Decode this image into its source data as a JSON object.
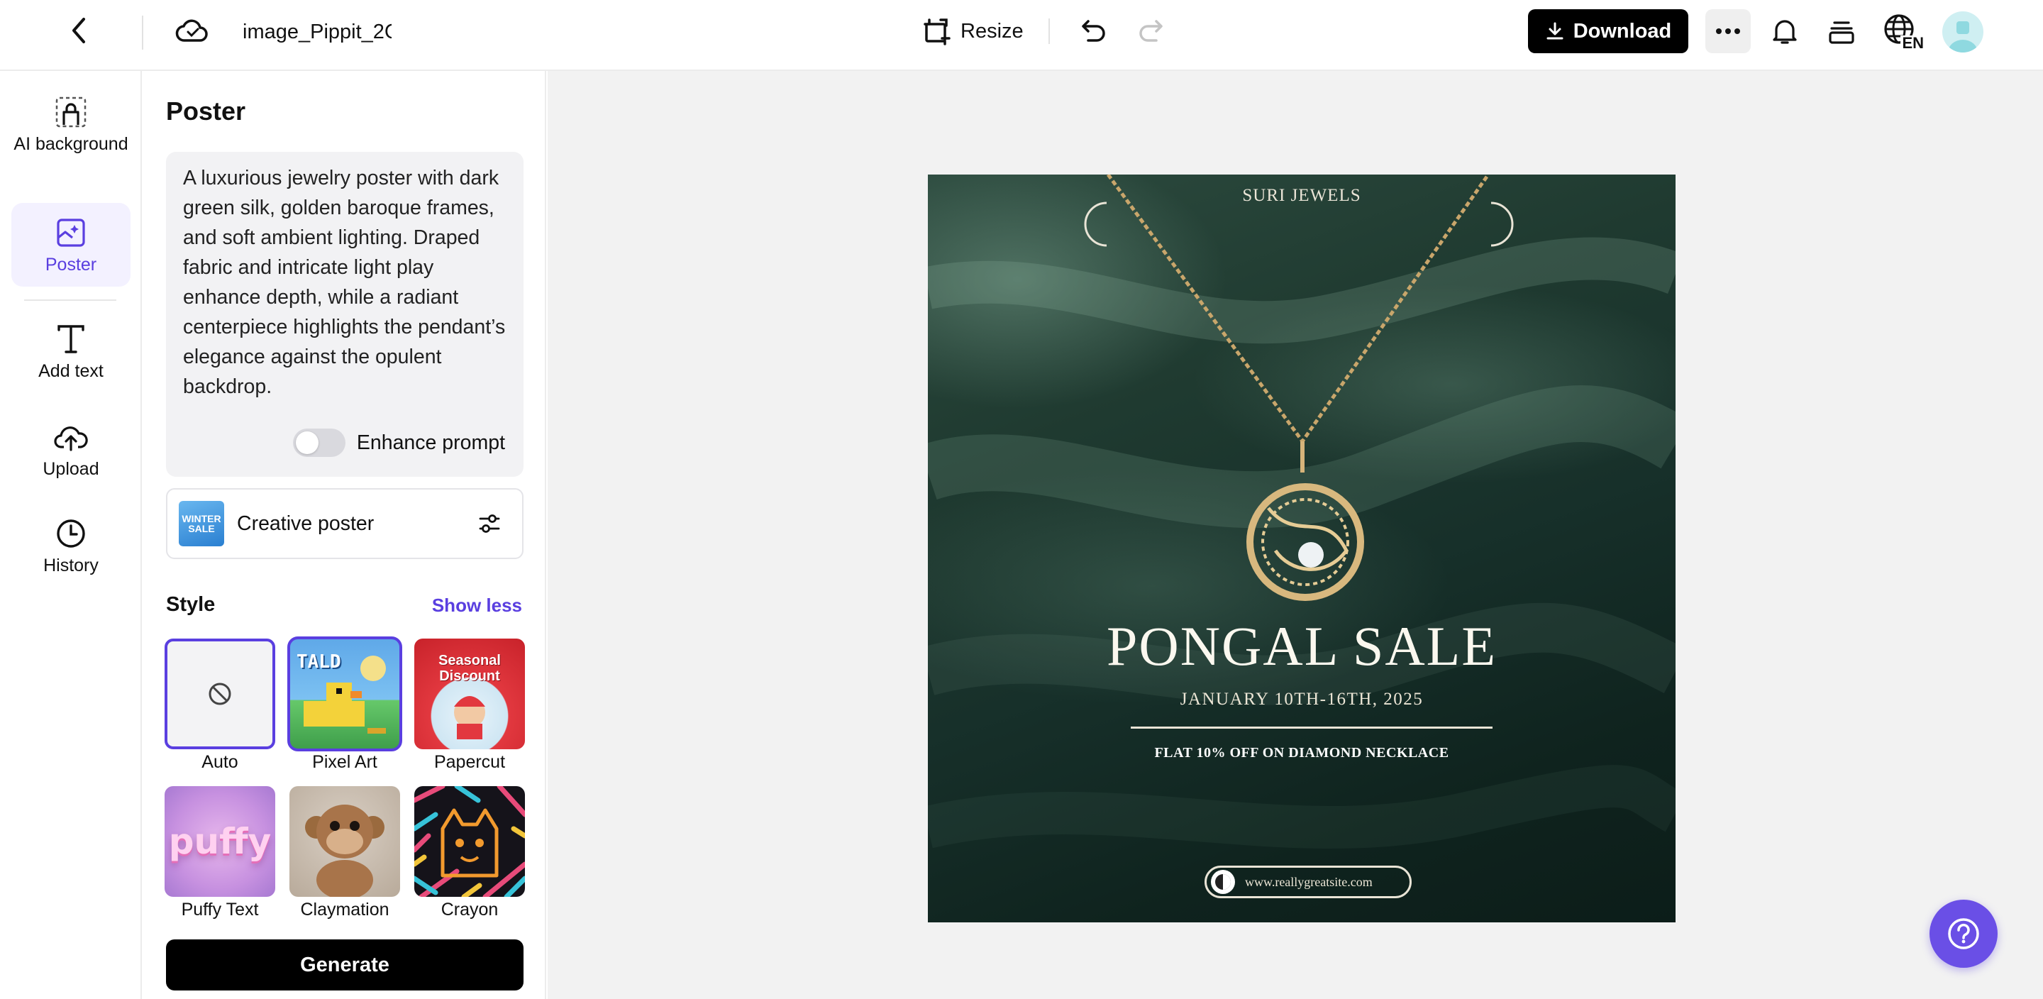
{
  "header": {
    "document_title": "image_Pippit_2C",
    "resize_label": "Resize",
    "download_label": "Download",
    "language_code": "EN"
  },
  "sidebar": {
    "items": [
      {
        "label": "AI background",
        "icon": "ai-background-icon",
        "active": false
      },
      {
        "label": "Poster",
        "icon": "poster-icon",
        "active": true
      },
      {
        "label": "Add text",
        "icon": "text-icon",
        "active": false
      },
      {
        "label": "Upload",
        "icon": "upload-icon",
        "active": false
      },
      {
        "label": "History",
        "icon": "history-icon",
        "active": false
      }
    ]
  },
  "panel": {
    "title": "Poster",
    "prompt": "A luxurious jewelry poster with dark green silk, golden baroque frames, and soft ambient lighting. Draped fabric and intricate light play enhance depth, while a radiant centerpiece highlights the pendant’s elegance against the opulent backdrop.",
    "enhance_prompt_label": "Enhance prompt",
    "enhance_prompt_enabled": false,
    "creative_label": "Creative poster",
    "creative_thumb_text": "WINTER SALE",
    "style_title": "Style",
    "show_less_label": "Show less",
    "styles": [
      {
        "label": "Auto",
        "selected": false,
        "thumb_text": ""
      },
      {
        "label": "Pixel Art",
        "selected": true,
        "thumb_text": "TALD"
      },
      {
        "label": "Papercut",
        "selected": false,
        "thumb_text": "Seasonal Discount"
      },
      {
        "label": "Puffy Text",
        "selected": false,
        "thumb_text": "puffy"
      },
      {
        "label": "Claymation",
        "selected": false,
        "thumb_text": ""
      },
      {
        "label": "Crayon",
        "selected": false,
        "thumb_text": ""
      }
    ],
    "generate_label": "Generate"
  },
  "poster": {
    "brand": "SURI JEWELS",
    "title": "PONGAL SALE",
    "dates": "JANUARY 10TH-16TH, 2025",
    "offer": "FLAT 10% OFF ON DIAMOND NECKLACE",
    "url": "www.reallygreatsite.com"
  },
  "colors": {
    "accent": "#5a3fe0",
    "help_button": "#6a4fe6",
    "primary_button": "#000000",
    "silk_green": "#1f3a30"
  }
}
